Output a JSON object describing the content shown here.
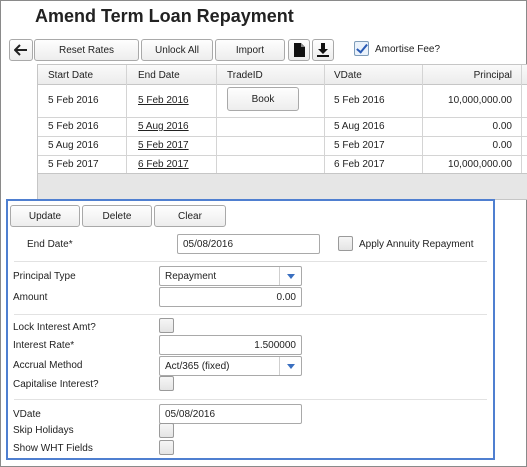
{
  "window": {
    "title": "Amend Term Loan Repayment"
  },
  "toolbar": {
    "reset_rates": "Reset Rates",
    "unlock_all": "Unlock All",
    "import": "Import",
    "amortise_fee_label": "Amortise Fee?",
    "amortise_fee_checked": true
  },
  "grid": {
    "columns": [
      "Start Date",
      "End Date",
      "TradeID",
      "VDate",
      "Principal"
    ],
    "book_label": "Book",
    "rows": [
      {
        "start": "5 Feb 2016",
        "end": "5 Feb 2016",
        "trade": "",
        "vdate": "5 Feb 2016",
        "principal": "10,000,000.00"
      },
      {
        "start": "5 Feb 2016",
        "end": "5 Aug 2016",
        "trade": "",
        "vdate": "5 Aug 2016",
        "principal": "0.00"
      },
      {
        "start": "5 Aug 2016",
        "end": "5 Feb 2017",
        "trade": "",
        "vdate": "5 Feb 2017",
        "principal": "0.00"
      },
      {
        "start": "5 Feb 2017",
        "end": "6 Feb 2017",
        "trade": "",
        "vdate": "6 Feb 2017",
        "principal": "10,000,000.00"
      }
    ]
  },
  "form": {
    "update": "Update",
    "delete": "Delete",
    "clear": "Clear",
    "end_date_label": "End Date*",
    "end_date_value": "05/08/2016",
    "apply_annuity_label": "Apply Annuity Repayment",
    "apply_annuity_checked": false,
    "principal_type_label": "Principal Type",
    "principal_type_value": "Repayment",
    "amount_label": "Amount",
    "amount_value": "0.00",
    "lock_interest_label": "Lock Interest Amt?",
    "lock_interest_checked": false,
    "interest_rate_label": "Interest Rate*",
    "interest_rate_value": "1.500000",
    "accrual_method_label": "Accrual Method",
    "accrual_method_value": "Act/365 (fixed)",
    "capitalise_label": "Capitalise Interest?",
    "capitalise_checked": false,
    "vdate_label": "VDate",
    "vdate_value": "05/08/2016",
    "skip_holidays_label": "Skip Holidays",
    "skip_holidays_checked": false,
    "show_wht_label": "Show WHT Fields",
    "show_wht_checked": false
  },
  "icons": {
    "back": "arrow-left-icon",
    "document": "document-icon",
    "download": "download-icon",
    "dropdown": "chevron-down-icon",
    "check": "check-icon"
  }
}
